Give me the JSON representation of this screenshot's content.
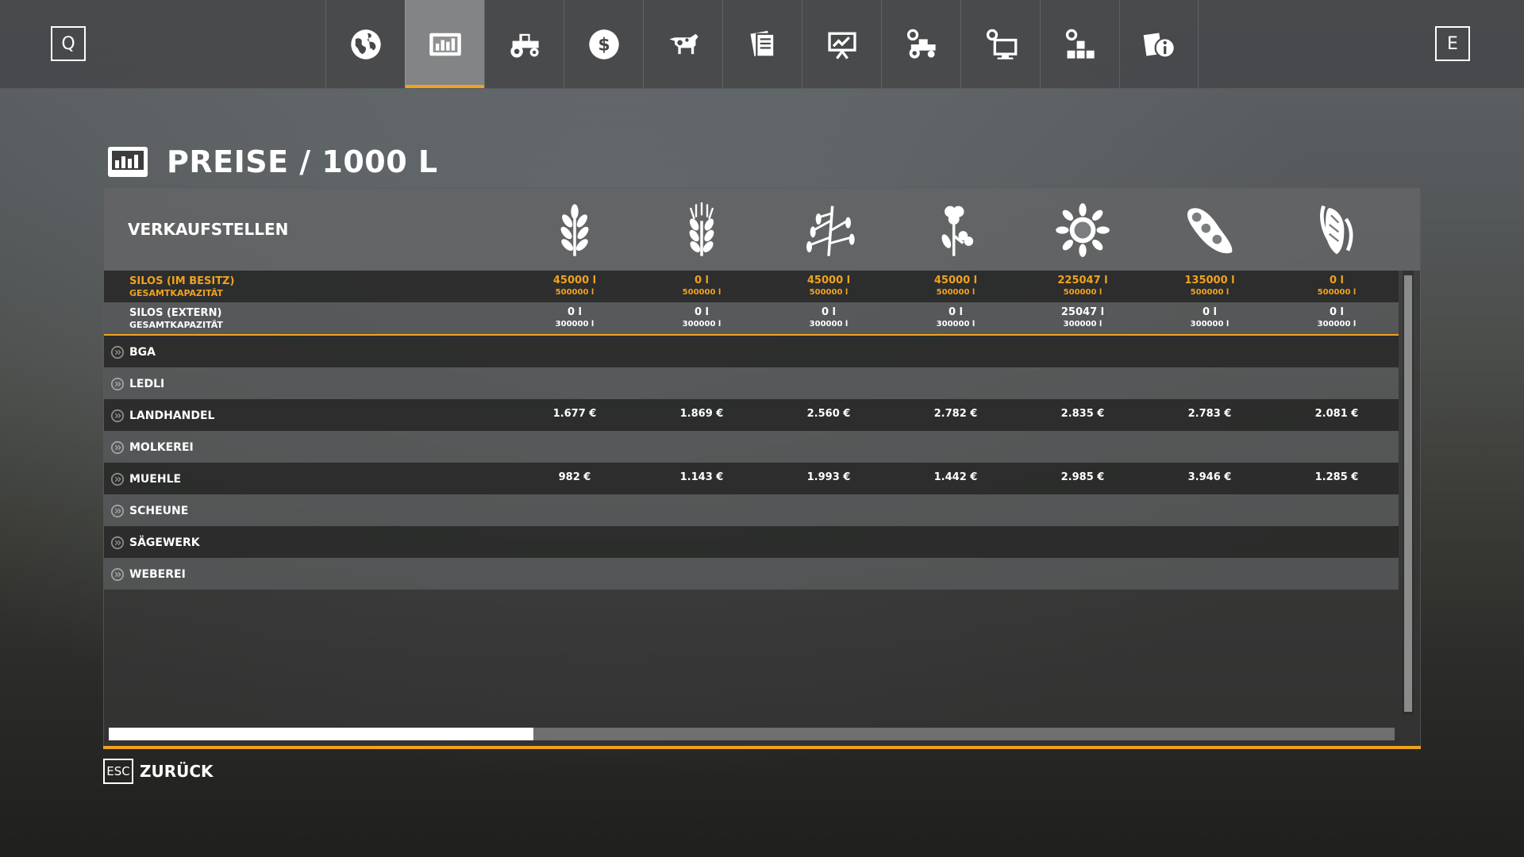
{
  "topbar": {
    "left_key": "Q",
    "right_key": "E",
    "tabs": [
      {
        "icon": "globe-icon"
      },
      {
        "icon": "prices-chart-icon",
        "active": true
      },
      {
        "icon": "tractor-icon"
      },
      {
        "icon": "dollar-icon"
      },
      {
        "icon": "cow-icon"
      },
      {
        "icon": "contracts-icon"
      },
      {
        "icon": "statistics-board-icon"
      },
      {
        "icon": "vehicle-settings-icon"
      },
      {
        "icon": "display-settings-icon"
      },
      {
        "icon": "production-icon"
      },
      {
        "icon": "help-info-icon"
      }
    ]
  },
  "page": {
    "title": "PREISE / 1000 L"
  },
  "table": {
    "header_label": "VERKAUFSTELLEN",
    "fill_types": [
      {
        "icon": "wheat-icon"
      },
      {
        "icon": "barley-icon"
      },
      {
        "icon": "oat-icon"
      },
      {
        "icon": "canola-icon"
      },
      {
        "icon": "sunflower-icon"
      },
      {
        "icon": "soybean-icon"
      },
      {
        "icon": "maize-icon"
      }
    ],
    "silos_own": {
      "label": "SILOS (IM BESITZ)",
      "sublabel": "GESAMTKAPAZITÄT",
      "amounts": [
        "45000 l",
        "0 l",
        "45000 l",
        "45000 l",
        "225047 l",
        "135000 l",
        "0 l"
      ],
      "capacities": [
        "500000 l",
        "500000 l",
        "500000 l",
        "500000 l",
        "500000 l",
        "500000 l",
        "500000 l"
      ]
    },
    "silos_ext": {
      "label": "SILOS (EXTERN)",
      "sublabel": "GESAMTKAPAZITÄT",
      "amounts": [
        "0 l",
        "0 l",
        "0 l",
        "0 l",
        "25047 l",
        "0 l",
        "0 l"
      ],
      "capacities": [
        "300000 l",
        "300000 l",
        "300000 l",
        "300000 l",
        "300000 l",
        "300000 l",
        "300000 l"
      ]
    },
    "stations": [
      {
        "name": "BGA",
        "prices": [
          "",
          "",
          "",
          "",
          "",
          "",
          ""
        ]
      },
      {
        "name": "LEDLI",
        "prices": [
          "",
          "",
          "",
          "",
          "",
          "",
          ""
        ]
      },
      {
        "name": "LANDHANDEL",
        "prices": [
          "1.677 €",
          "1.869 €",
          "2.560 €",
          "2.782 €",
          "2.835 €",
          "2.783 €",
          "2.081 €"
        ]
      },
      {
        "name": "MOLKEREI",
        "prices": [
          "",
          "",
          "",
          "",
          "",
          "",
          ""
        ]
      },
      {
        "name": "MUEHLE",
        "prices": [
          "982 €",
          "1.143 €",
          "1.993 €",
          "1.442 €",
          "2.985 €",
          "3.946 €",
          "1.285 €"
        ]
      },
      {
        "name": "SCHEUNE",
        "prices": [
          "",
          "",
          "",
          "",
          "",
          "",
          ""
        ]
      },
      {
        "name": "SÄGEWERK",
        "prices": [
          "",
          "",
          "",
          "",
          "",
          "",
          ""
        ]
      },
      {
        "name": "WEBEREI",
        "prices": [
          "",
          "",
          "",
          "",
          "",
          "",
          ""
        ]
      }
    ],
    "horizontal_scroll_fraction": 0.33
  },
  "footer": {
    "back_key": "ESC",
    "back_label": "ZURÜCK"
  },
  "colors": {
    "accent": "#f0a21f",
    "text": "#ffffff"
  }
}
